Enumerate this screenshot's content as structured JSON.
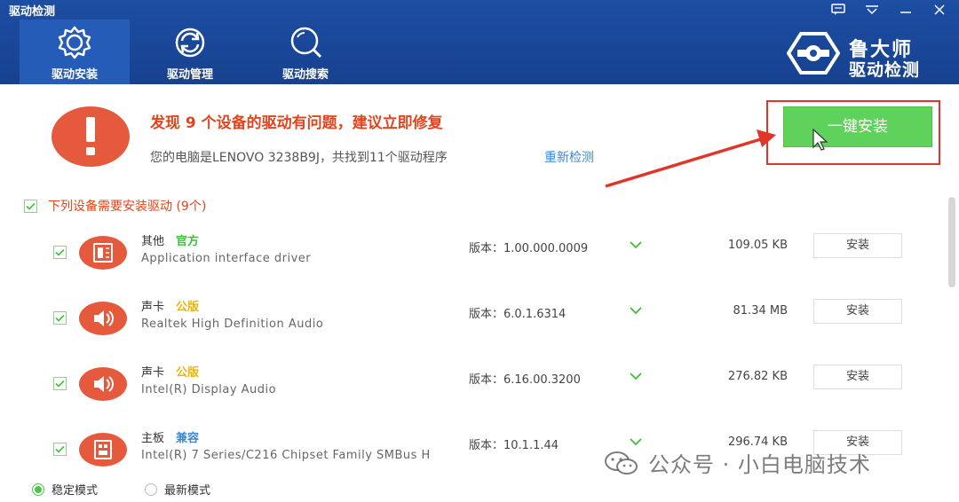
{
  "window": {
    "title": "驱动检测",
    "controls": [
      "chat-icon",
      "menu-icon",
      "minimize-icon",
      "close-icon"
    ]
  },
  "nav": {
    "tabs": [
      {
        "label": "驱动安装",
        "icon": "gear-icon",
        "active": true
      },
      {
        "label": "驱动管理",
        "icon": "refresh-icon",
        "active": false
      },
      {
        "label": "驱动搜索",
        "icon": "search-icon",
        "active": false
      }
    ]
  },
  "brand": {
    "name": "鲁大师",
    "sub": "驱动检测",
    "icon": "ludashi-logo"
  },
  "summary": {
    "headline": "发现 9 个设备的驱动有问题，建议立即修复",
    "system_info": "您的电脑是LENOVO 3238B9J，共找到11个驱动程序",
    "rescan_label": "重新检测",
    "install_all_label": "一键安装"
  },
  "section": {
    "title": "下列设备需要安装驱动 (9个)",
    "checked": true
  },
  "devices": [
    {
      "category": "其他",
      "tag": "官方",
      "tag_color": "#3fbf3a",
      "name": "Application interface driver",
      "version": "版本：1.00.000.0009",
      "size": "109.05 KB",
      "action": "安装",
      "icon": "chip-card-icon",
      "checked": true
    },
    {
      "category": "声卡",
      "tag": "公版",
      "tag_color": "#f0b400",
      "name": "Realtek High Definition Audio",
      "version": "版本：6.0.1.6314",
      "size": "81.34 MB",
      "action": "安装",
      "icon": "speaker-icon",
      "checked": true
    },
    {
      "category": "声卡",
      "tag": "公版",
      "tag_color": "#f0b400",
      "name": "Intel(R) Display Audio",
      "version": "版本：6.16.00.3200",
      "size": "276.82 KB",
      "action": "安装",
      "icon": "speaker-icon",
      "checked": true
    },
    {
      "category": "主板",
      "tag": "兼容",
      "tag_color": "#3a86d6",
      "name": "Intel(R) 7 Series/C216 Chipset Family SMBus H",
      "version": "版本：10.1.1.44",
      "size": "296.74 KB",
      "action": "安装",
      "icon": "motherboard-icon",
      "checked": true
    }
  ],
  "footer": {
    "modes": [
      {
        "label": "稳定模式",
        "selected": true
      },
      {
        "label": "最新模式",
        "selected": false
      }
    ]
  },
  "watermark": {
    "text": "公众号 · 小白电脑技术",
    "icon": "wechat-icon"
  },
  "colors": {
    "header": "#1d4ea3",
    "accent_red": "#e55a3c",
    "install_green": "#5fd25c",
    "link_blue": "#3a86d6"
  }
}
